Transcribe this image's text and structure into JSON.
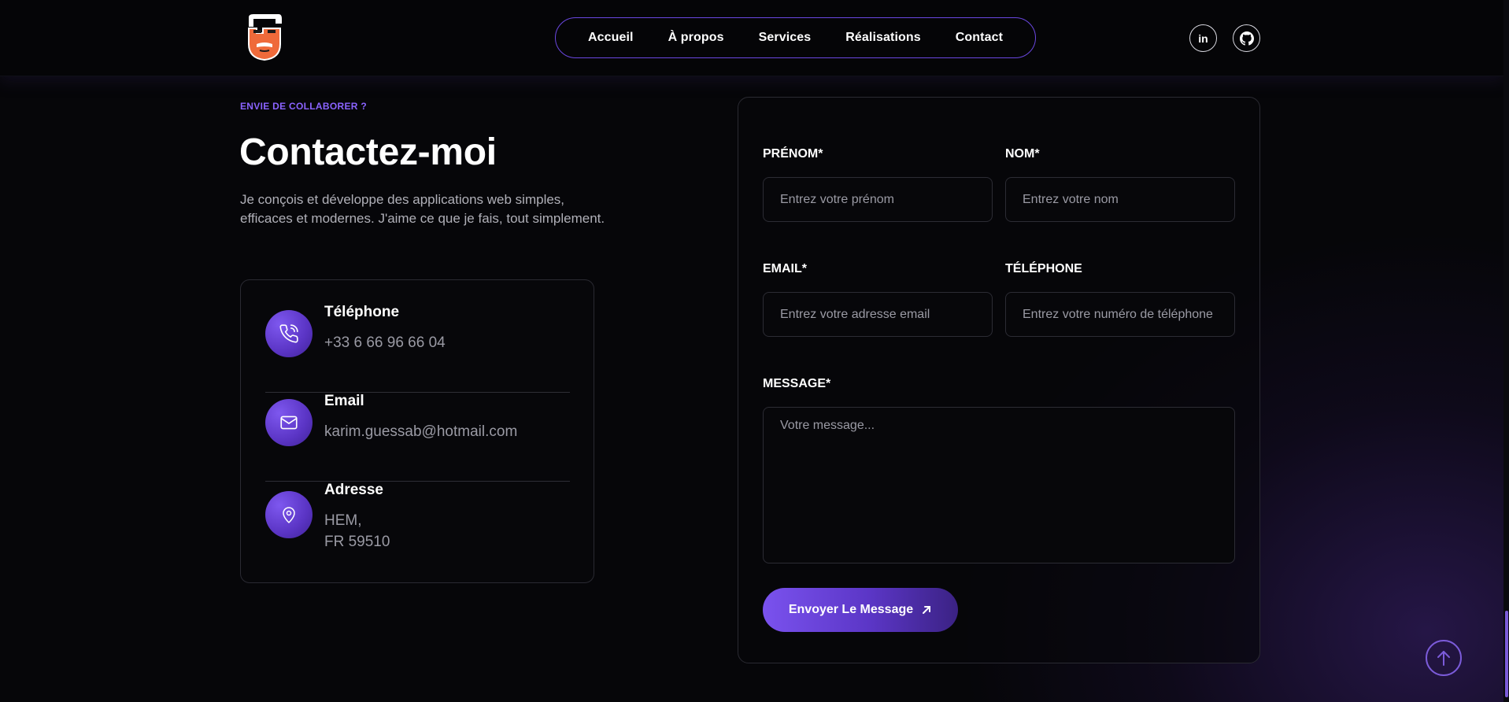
{
  "header": {
    "nav": [
      "Accueil",
      "À propos",
      "Services",
      "Réalisations",
      "Contact"
    ],
    "social": {
      "linkedin": "in"
    }
  },
  "contact": {
    "eyebrow": "ENVIE DE COLLABORER ?",
    "title": "Contactez-moi",
    "intro": "Je conçois et développe des applications web simples, efficaces et modernes. J'aime ce que je fais, tout simplement.",
    "items": [
      {
        "label": "Téléphone",
        "value": "+33 6 66 96 66 04",
        "icon": "phone-icon"
      },
      {
        "label": "Email",
        "value": "karim.guessab@hotmail.com",
        "icon": "mail-icon"
      },
      {
        "label": "Adresse",
        "value_line1": "HEM,",
        "value_line2": "FR 59510",
        "icon": "location-pin-icon"
      }
    ]
  },
  "form": {
    "firstname": {
      "label": "PRÉNOM*",
      "placeholder": "Entrez votre prénom"
    },
    "lastname": {
      "label": "NOM*",
      "placeholder": "Entrez votre nom"
    },
    "email": {
      "label": "EMAIL*",
      "placeholder": "Entrez votre adresse email"
    },
    "phone": {
      "label": "TÉLÉPHONE",
      "placeholder": "Entrez votre numéro de téléphone"
    },
    "message": {
      "label": "MESSAGE*",
      "placeholder": "Votre message..."
    },
    "submit": "Envoyer Le Message"
  },
  "colors": {
    "accent": "#7b5bd9",
    "eyebrow": "#8a63ff",
    "background": "#060609"
  }
}
